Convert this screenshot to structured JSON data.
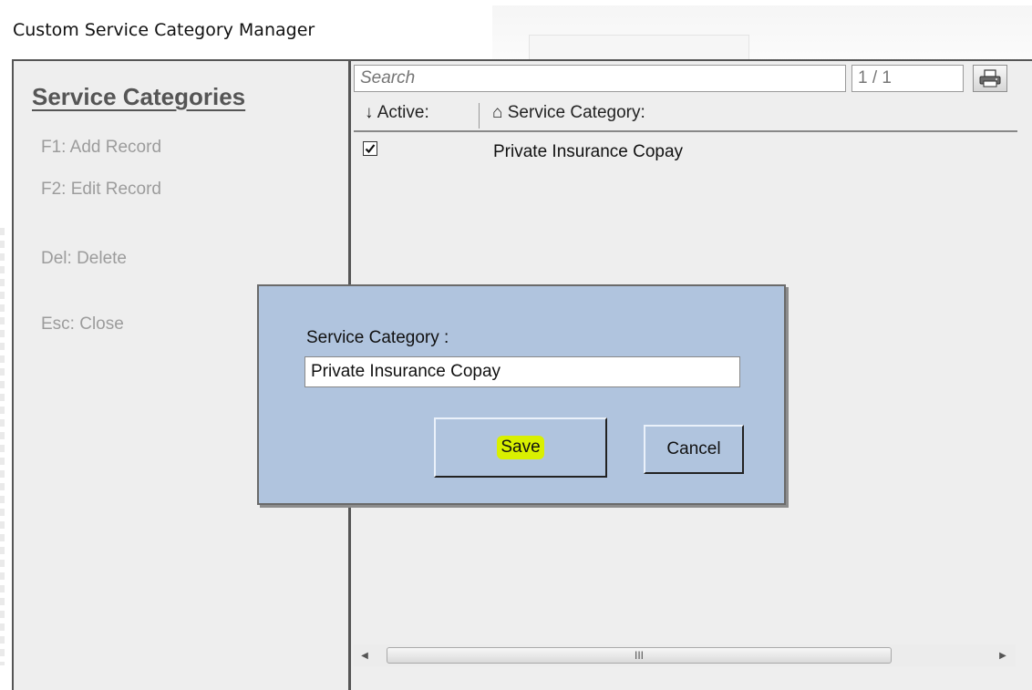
{
  "window": {
    "title": "Custom Service Category Manager"
  },
  "sidebar": {
    "title": "Service Categories",
    "shortcuts": [
      {
        "label": "F1: Add Record"
      },
      {
        "label": "F2: Edit Record"
      },
      {
        "label": "Del: Delete"
      },
      {
        "label": "Esc: Close"
      }
    ]
  },
  "toolbar": {
    "search_placeholder": "Search",
    "page_indicator": "1 / 1",
    "print_icon": "printer-icon"
  },
  "grid": {
    "columns": [
      {
        "label": "↓ Active:"
      },
      {
        "label": "⌂ Service Category:"
      }
    ],
    "rows": [
      {
        "active": true,
        "category": "Private Insurance Copay"
      }
    ],
    "scrollbar_grip": "III"
  },
  "dialog": {
    "field_label": "Service Category :",
    "field_value": "Private Insurance Copay",
    "save_label": "Save",
    "cancel_label": "Cancel",
    "highlight_color": "#d9f000",
    "background_color": "#b0c4de"
  }
}
